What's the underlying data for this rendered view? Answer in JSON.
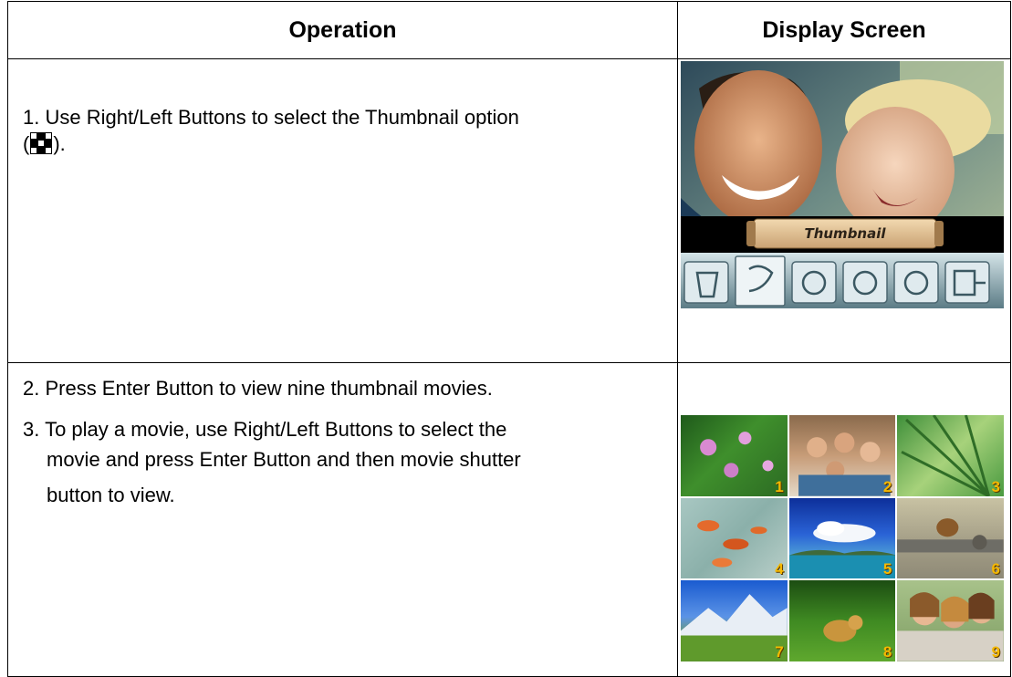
{
  "table": {
    "header": {
      "operation": "Operation",
      "display": "Display Screen"
    },
    "rows": [
      {
        "steps": [
          "1. Use Right/Left Buttons to select the Thumbnail option",
          "(",
          ")."
        ],
        "screen_label": "Thumbnail"
      },
      {
        "steps": [
          "2. Press Enter Button to view nine thumbnail movies.",
          "3. To play a movie, use Right/Left Buttons to select the",
          "movie and press Enter Button and then movie shutter",
          "button to view."
        ],
        "thumbnail_numbers": [
          "1",
          "2",
          "3",
          "4",
          "5",
          "6",
          "7",
          "8",
          "9"
        ]
      }
    ]
  }
}
